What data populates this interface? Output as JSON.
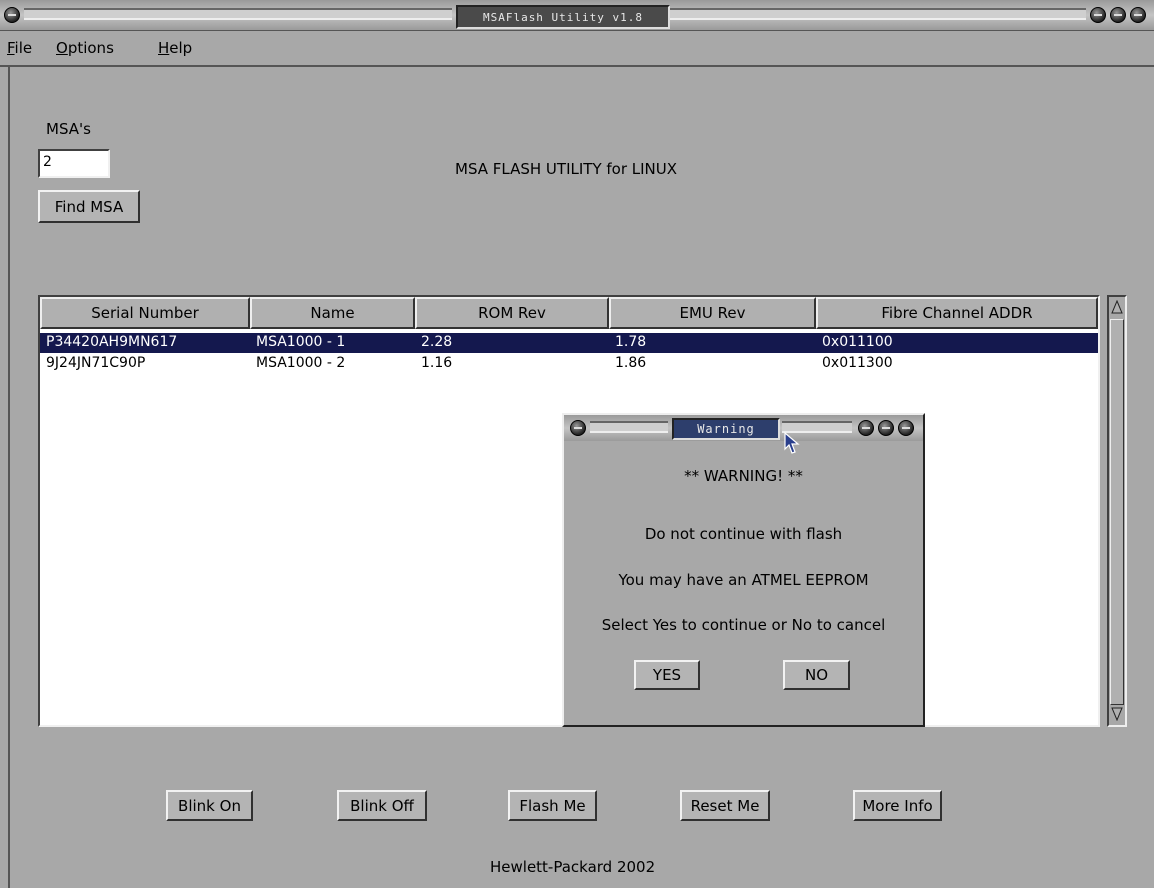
{
  "window": {
    "title": "MSAFlash Utility v1.8"
  },
  "menu": [
    {
      "label": "File",
      "mnemonic": "F",
      "rest": "ile"
    },
    {
      "label": "Options",
      "mnemonic": "O",
      "rest": "ptions"
    },
    {
      "label": "Help",
      "mnemonic": "H",
      "rest": "elp"
    }
  ],
  "msa_count": {
    "label": "MSA's",
    "value": "2"
  },
  "find_button": "Find MSA",
  "heading": "MSA FLASH UTILITY for LINUX",
  "table": {
    "columns": [
      "Serial Number",
      "Name",
      "ROM Rev",
      "EMU Rev",
      "Fibre Channel ADDR"
    ],
    "rows": [
      [
        "P34420AH9MN617",
        "MSA1000 - 1",
        "2.28",
        "1.78",
        "0x011100"
      ],
      [
        "9J24JN71C90P",
        "MSA1000 - 2",
        "1.16",
        "1.86",
        "0x011300"
      ]
    ],
    "selected_row": 0
  },
  "actions": {
    "blink_on": "Blink On",
    "blink_off": "Blink Off",
    "flash_me": "Flash Me",
    "reset_me": "Reset Me",
    "more_info": "More Info"
  },
  "footer": "Hewlett-Packard 2002",
  "dialog": {
    "title": "Warning",
    "heading": "** WARNING! **",
    "line1": "Do not continue with flash",
    "line2": "You may have an ATMEL EEPROM",
    "line3": "Select Yes to continue or No to cancel",
    "yes": "YES",
    "no": "NO"
  },
  "colors": {
    "window_bg": "#a8a8a8",
    "selection": "#14184e",
    "dialog_title": "#2d3e6c"
  }
}
